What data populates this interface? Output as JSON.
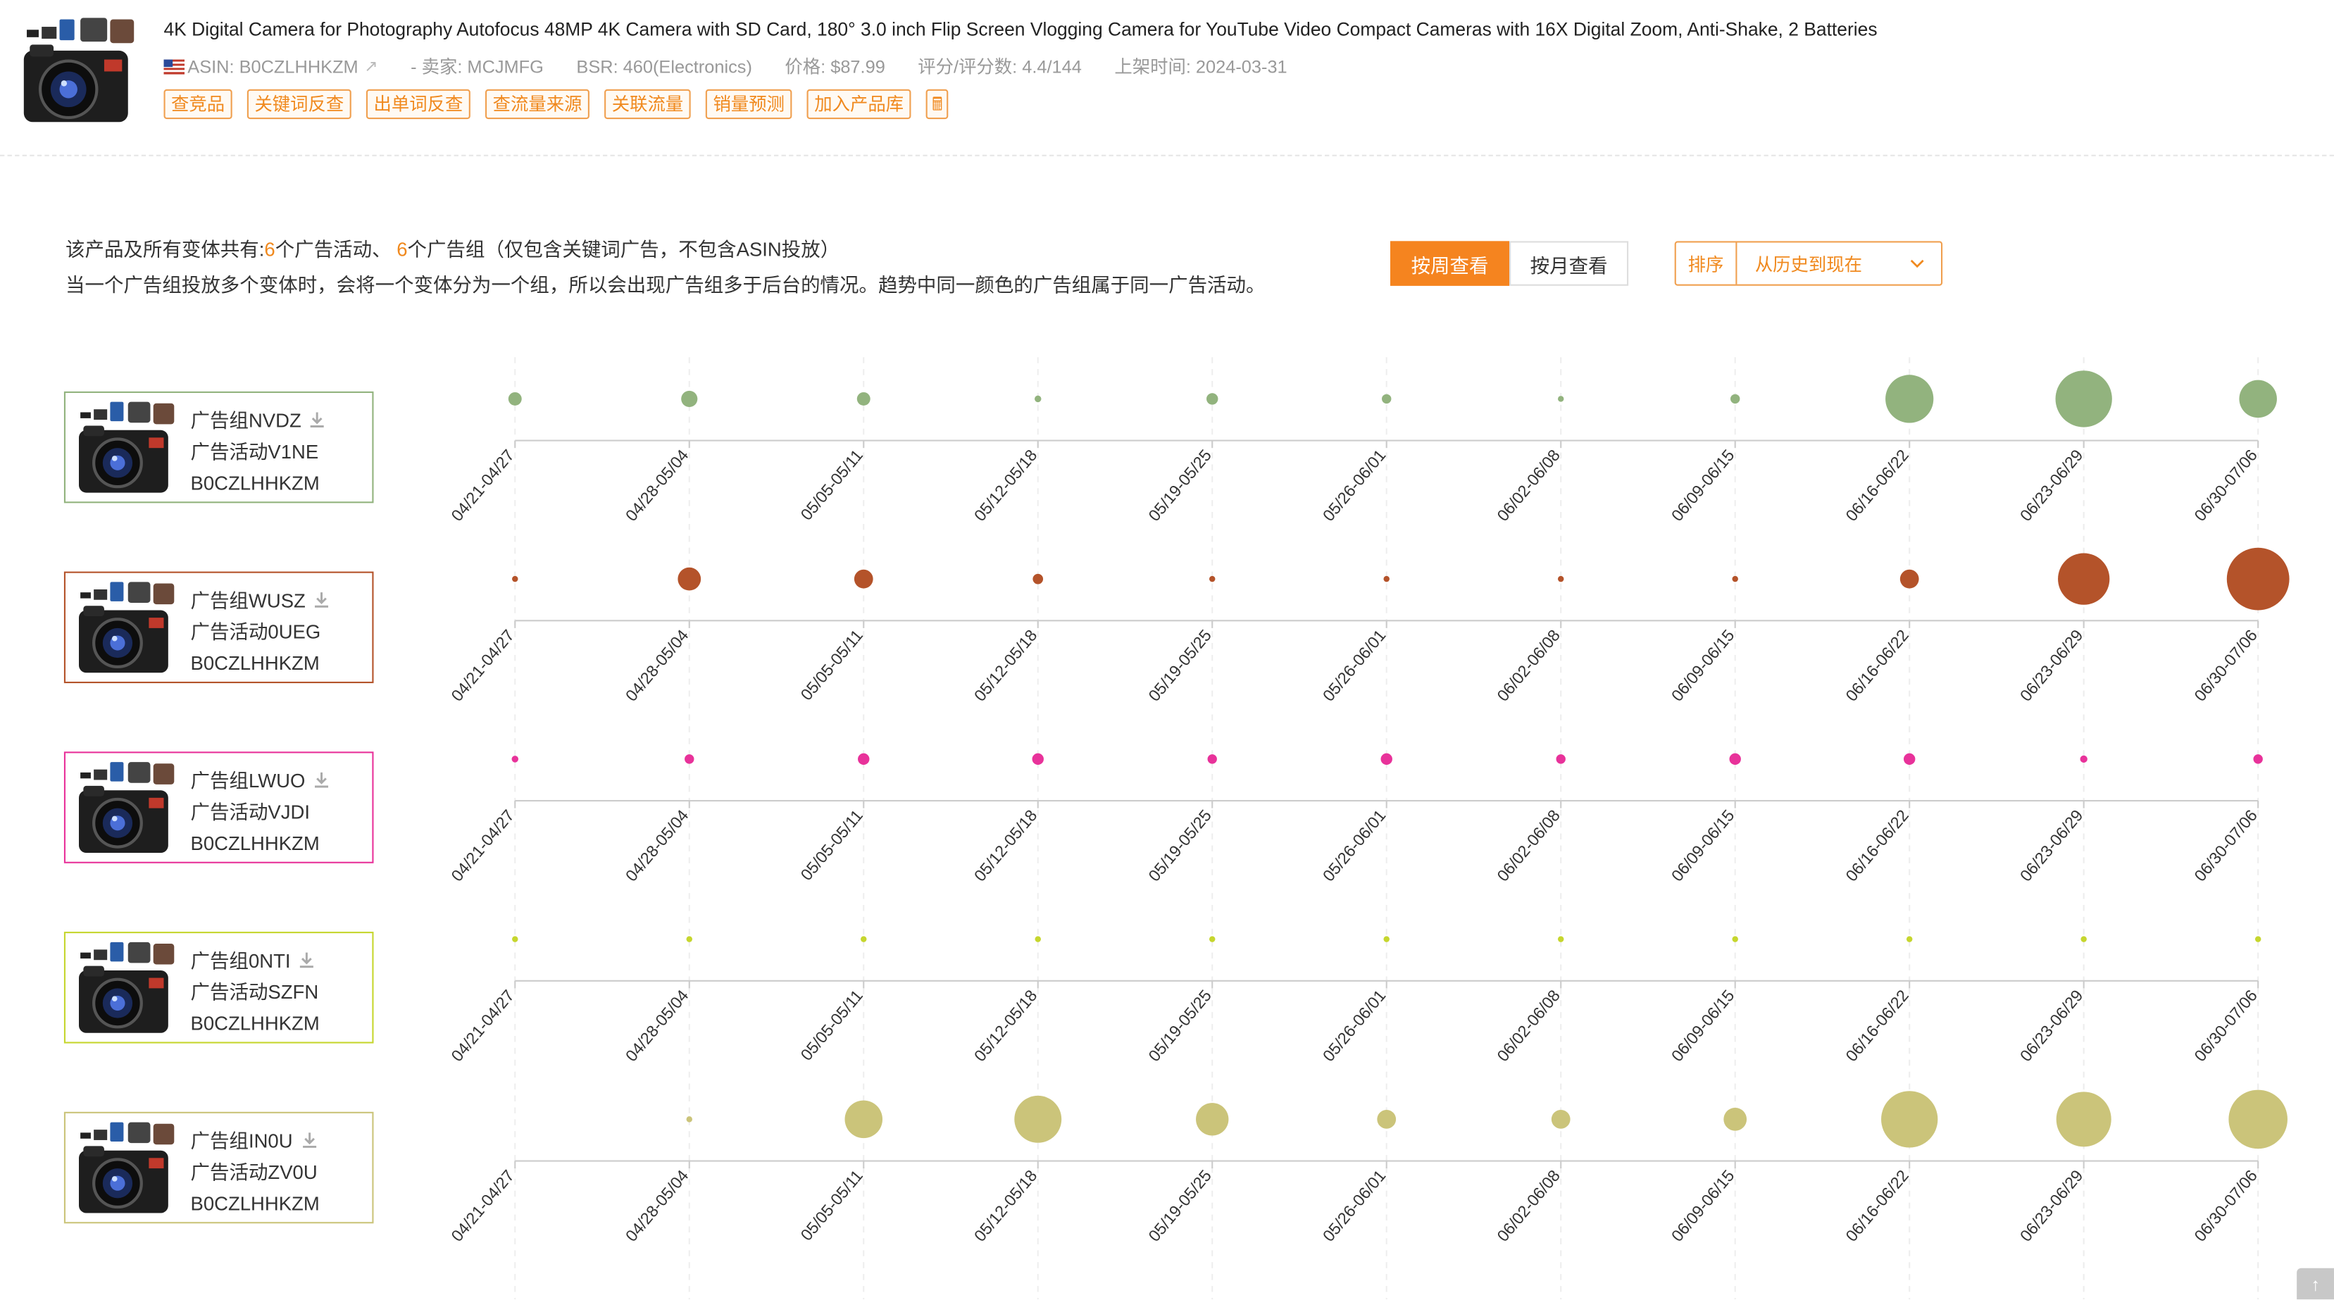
{
  "product": {
    "title": "4K Digital Camera for Photography Autofocus 48MP 4K Camera with SD Card, 180° 3.0 inch Flip Screen Vlogging Camera for YouTube Video Compact Cameras with 16X Digital Zoom, Anti-Shake, 2 Batteries",
    "asin": "ASIN: B0CZLHHKZM",
    "seller": "- 卖家: MCJMFG",
    "bsr": "BSR: 460(Electronics)",
    "price": "价格: $87.99",
    "rating": "评分/评分数: 4.4/144",
    "listed": "上架时间: 2024-03-31",
    "tools": [
      "查竞品",
      "关键词反查",
      "出单词反查",
      "查流量来源",
      "关联流量",
      "销量预测",
      "加入产品库"
    ]
  },
  "summary": {
    "prefix": "该产品及所有变体共有:",
    "campaign_count": "6",
    "campaign_text": "个广告活动、",
    "group_count": "6",
    "group_text": "个广告组（仅包含关键词广告，不包含ASIN投放）",
    "note": "当一个广告组投放多个变体时，会将一个变体分为一个组，所以会出现广告组多于后台的情况。趋势中同一颜色的广告组属于同一广告活动。"
  },
  "view": {
    "weekly_label": "按周查看",
    "monthly_label": "按月查看",
    "active": "weekly"
  },
  "sort": {
    "label": "排序",
    "value": "从历史到现在"
  },
  "groups": [
    {
      "group": "广告组NVDZ",
      "campaign": "广告活动V1NE",
      "asin": "B0CZLHHKZM",
      "color": "#92b37e"
    },
    {
      "group": "广告组WUSZ",
      "campaign": "广告活动0UEG",
      "asin": "B0CZLHHKZM",
      "color": "#b4532a"
    },
    {
      "group": "广告组LWUO",
      "campaign": "广告活动VJDI",
      "asin": "B0CZLHHKZM",
      "color": "#e8329a"
    },
    {
      "group": "广告组0NTI",
      "campaign": "广告活动SZFN",
      "asin": "B0CZLHHKZM",
      "color": "#c6d62e"
    },
    {
      "group": "广告组IN0U",
      "campaign": "广告活动ZV0U",
      "asin": "B0CZLHHKZM",
      "color": "#cbc47a"
    }
  ],
  "chart_data": {
    "type": "scatter",
    "categories": [
      "04/21-04/27",
      "04/28-05/04",
      "05/05-05/11",
      "05/12-05/18",
      "05/19-05/25",
      "05/26-06/01",
      "06/02-06/08",
      "06/09-06/15",
      "06/16-06/22",
      "06/23-06/29",
      "06/30-07/06"
    ],
    "series": [
      {
        "name": "广告组NVDZ",
        "values": [
          0.2,
          0.3,
          0.2,
          0.05,
          0.15,
          0.1,
          0.03,
          0.1,
          2.6,
          3.6,
          1.6
        ]
      },
      {
        "name": "广告组WUSZ",
        "values": [
          0.03,
          0.6,
          0.4,
          0.12,
          0.03,
          0.03,
          0.03,
          0.03,
          0.4,
          3.0,
          4.4
        ]
      },
      {
        "name": "广告组LWUO",
        "values": [
          0.05,
          0.1,
          0.15,
          0.15,
          0.1,
          0.15,
          0.1,
          0.15,
          0.15,
          0.06,
          0.1
        ]
      },
      {
        "name": "广告组0NTI",
        "values": [
          0.03,
          0.03,
          0.03,
          0.03,
          0.03,
          0.03,
          0.03,
          0.03,
          0.03,
          0.03,
          0.03
        ]
      },
      {
        "name": "广告组IN0U",
        "values": [
          0,
          0.03,
          1.6,
          2.5,
          1.2,
          0.4,
          0.4,
          0.6,
          3.6,
          3.4,
          3.9
        ]
      }
    ],
    "grid": true
  }
}
